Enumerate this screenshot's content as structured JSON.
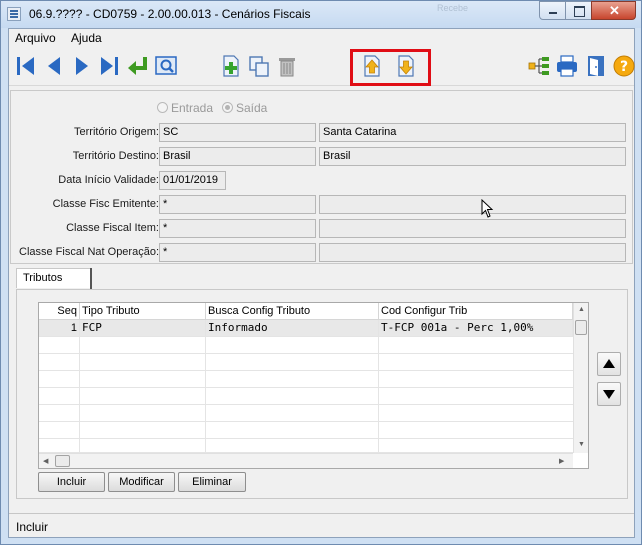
{
  "window": {
    "title": "06.9.???? - CD0759 - 2.00.00.013 - Cenários Fiscais",
    "ghost_text": "Recebe",
    "close_glyph": "✕"
  },
  "menu": {
    "items": [
      {
        "label": "Arquivo"
      },
      {
        "label": "Ajuda"
      }
    ]
  },
  "toolbar": {
    "buttons": [
      {
        "name": "first-record-icon"
      },
      {
        "name": "previous-record-icon"
      },
      {
        "name": "next-record-icon"
      },
      {
        "name": "last-record-icon"
      },
      {
        "name": "goto-enter-icon"
      },
      {
        "name": "search-icon"
      },
      {
        "name": "add-record-icon"
      },
      {
        "name": "copy-record-icon"
      },
      {
        "name": "delete-trash-icon"
      },
      {
        "name": "upload-export-icon"
      },
      {
        "name": "download-import-icon"
      },
      {
        "name": "hierarchy-tree-icon"
      },
      {
        "name": "printer-icon"
      },
      {
        "name": "exit-door-icon"
      },
      {
        "name": "help-icon"
      }
    ],
    "highlight_color": "#e00d15"
  },
  "form": {
    "radio": {
      "option1": "Entrada",
      "option2": "Saída",
      "selected": "Saída"
    },
    "territorio_origem": {
      "label": "Território Origem:",
      "code": "SC",
      "description": "Santa Catarina"
    },
    "territorio_destino": {
      "label": "Território Destino:",
      "code": "Brasil",
      "description": "Brasil"
    },
    "data_inicio": {
      "label": "Data Início Validade:",
      "value": "01/01/2019"
    },
    "classe_fisc_emitente": {
      "label": "Classe Fisc Emitente:",
      "code": "*",
      "description": ""
    },
    "classe_fiscal_item": {
      "label": "Classe Fiscal Item:",
      "code": "*",
      "description": ""
    },
    "classe_fiscal_nat": {
      "label": "Classe Fiscal Nat Operação:",
      "code": "*",
      "description": ""
    }
  },
  "tabs": {
    "active": "Tributos"
  },
  "grid": {
    "columns": [
      "Seq",
      "Tipo Tributo",
      "Busca Config Tributo",
      "Cod Configur Trib"
    ],
    "rows": [
      {
        "seq": "1",
        "tipo": "FCP",
        "busca": "Informado",
        "cod": "T-FCP 001a - Perc 1,00%"
      }
    ]
  },
  "buttons": {
    "incluir": "Incluir",
    "modificar": "Modificar",
    "eliminar": "Eliminar"
  },
  "status": {
    "text": "Incluir"
  }
}
